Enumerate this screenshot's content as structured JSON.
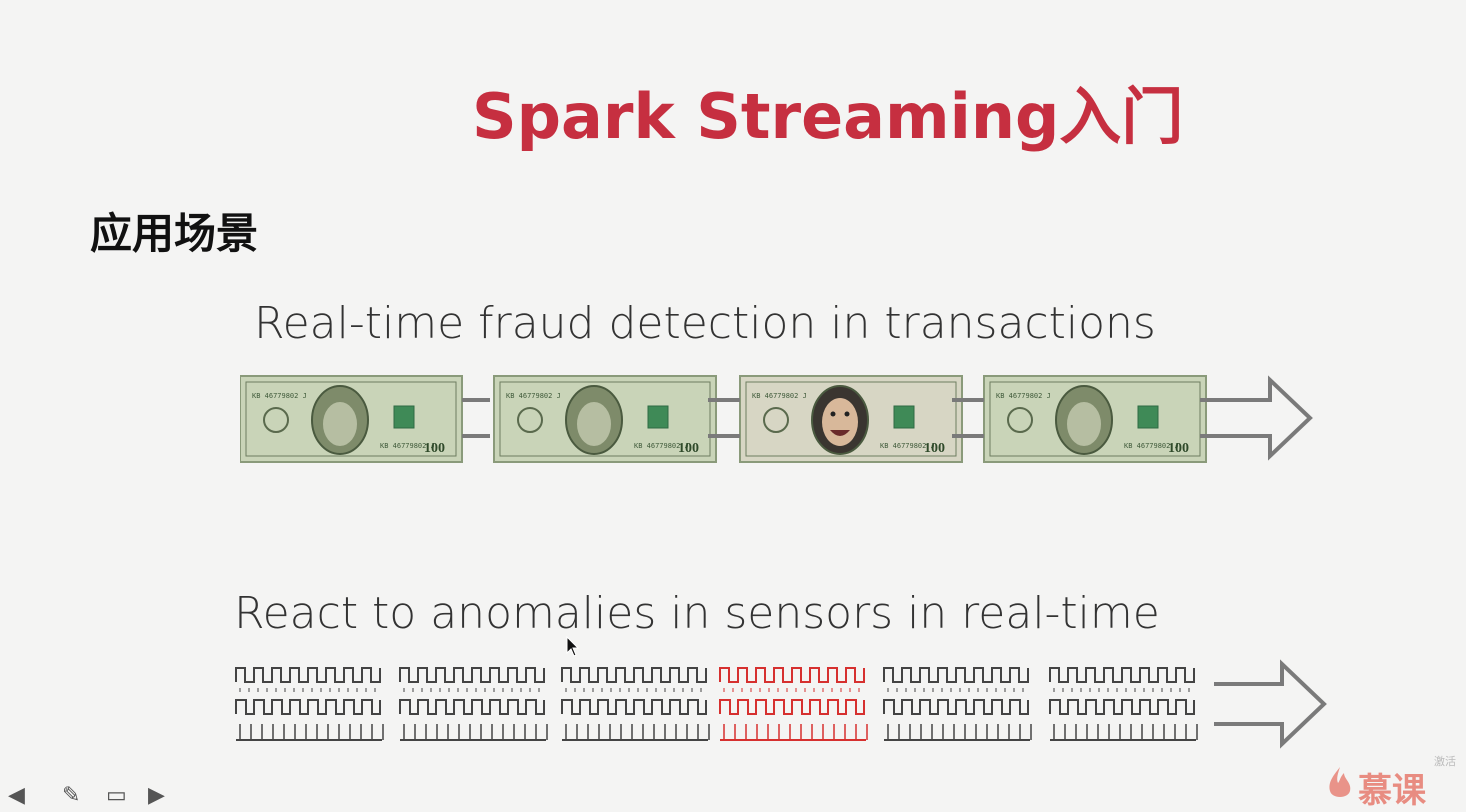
{
  "slide": {
    "title": "Spark Streaming入门",
    "heading": "应用场景",
    "scenes": [
      {
        "title": "Real-time fraud detection in transactions"
      },
      {
        "title": "React to anomalies in sensors in real-time"
      }
    ]
  },
  "bills": [
    {
      "kind": "genuine",
      "serial": "KB 46779802 J",
      "value": "100"
    },
    {
      "kind": "genuine",
      "serial": "KB 46779802 J",
      "value": "100"
    },
    {
      "kind": "fraud",
      "serial": "KB 46779802 J",
      "value": "100"
    },
    {
      "kind": "genuine",
      "serial": "KB 46779802 J",
      "value": "100"
    }
  ],
  "sensors": [
    {
      "status": "normal"
    },
    {
      "status": "normal"
    },
    {
      "status": "normal"
    },
    {
      "status": "anomaly"
    },
    {
      "status": "normal"
    },
    {
      "status": "normal"
    }
  ],
  "colors": {
    "title": "#c62f40",
    "sensor_normal": "#444444",
    "sensor_anomaly": "#d6302f",
    "arrow": "#7a7a7a",
    "bill_green": "#c9d4b8"
  },
  "icons": [
    "arrow-left-icon",
    "pen-icon",
    "screen-icon",
    "arrow-right-icon",
    "arrow-right-large-icon",
    "mouse-pointer-icon",
    "flame-icon"
  ],
  "brand": {
    "name": "慕课",
    "watermark": "激活"
  }
}
